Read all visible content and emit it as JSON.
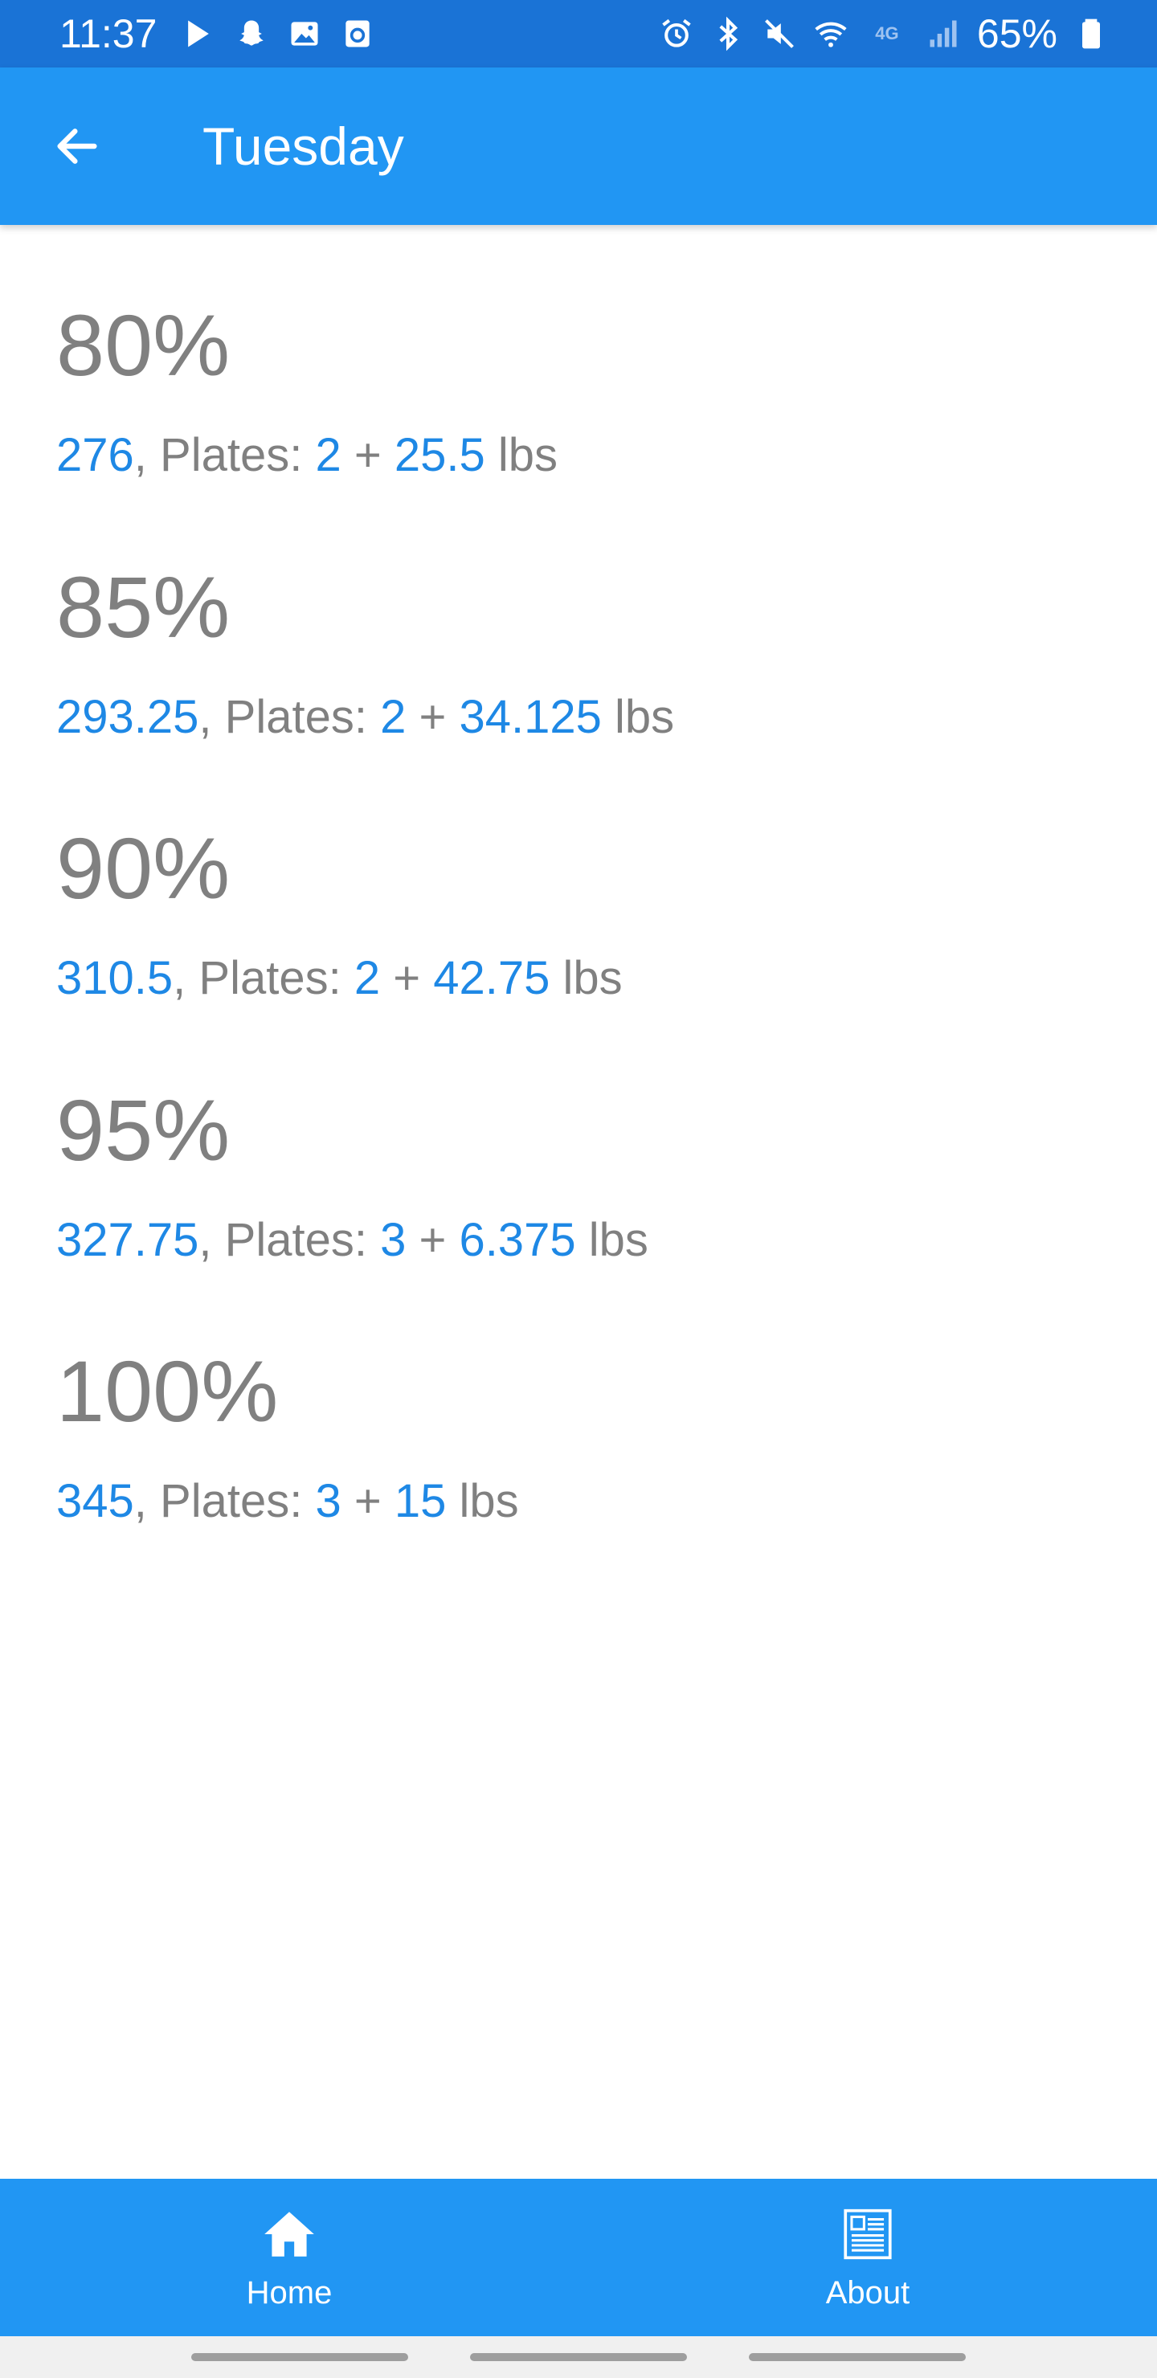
{
  "status_bar": {
    "time": "11:37",
    "battery": "65%",
    "network": "4G",
    "left_icons": [
      "music-icon",
      "snapchat-icon",
      "gallery-icon",
      "app-icon"
    ],
    "right_icons": [
      "alarm-icon",
      "bluetooth-icon",
      "mute-icon",
      "wifi-icon",
      "signal-icon",
      "battery-icon"
    ]
  },
  "app_bar": {
    "title": "Tuesday",
    "back_icon": "arrow-back-icon",
    "color": "#2196f3"
  },
  "entries": [
    {
      "percent": "80%",
      "weight": "276",
      "plates_label": ", Plates: ",
      "plates": "2",
      "plus": " + ",
      "extra": "25.5",
      "unit": " lbs"
    },
    {
      "percent": "85%",
      "weight": "293.25",
      "plates_label": ", Plates: ",
      "plates": "2",
      "plus": " + ",
      "extra": "34.125",
      "unit": " lbs"
    },
    {
      "percent": "90%",
      "weight": "310.5",
      "plates_label": ", Plates: ",
      "plates": "2",
      "plus": " + ",
      "extra": "42.75",
      "unit": " lbs"
    },
    {
      "percent": "95%",
      "weight": "327.75",
      "plates_label": ", Plates: ",
      "plates": "3",
      "plus": " + ",
      "extra": "6.375",
      "unit": " lbs"
    },
    {
      "percent": "100%",
      "weight": "345",
      "plates_label": ", Plates: ",
      "plates": "3",
      "plus": " + ",
      "extra": "15",
      "unit": " lbs"
    }
  ],
  "bottom_nav": {
    "items": [
      {
        "label": "Home",
        "icon": "home-icon"
      },
      {
        "label": "About",
        "icon": "about-icon"
      }
    ]
  },
  "colors": {
    "accent": "#2196f3",
    "status_bar": "#1a73d6",
    "value_blue": "#1e88e5",
    "text_gray": "#808080"
  }
}
